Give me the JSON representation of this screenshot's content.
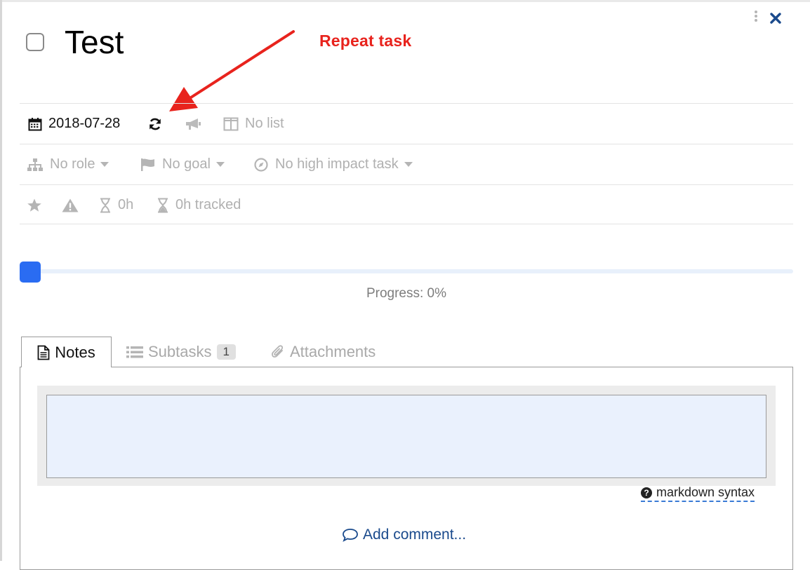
{
  "task": {
    "title": "Test",
    "completed": false
  },
  "annotation": {
    "text": "Repeat task"
  },
  "details": {
    "due_date": "2018-07-28",
    "list_label": "No list",
    "role_label": "No role",
    "goal_label": "No goal",
    "high_impact_label": "No high impact task",
    "estimate_label": "0h",
    "tracked_label": "0h tracked"
  },
  "progress": {
    "label": "Progress: 0%",
    "value": 0
  },
  "tabs": [
    {
      "label": "Notes",
      "icon": "document-icon",
      "active": true
    },
    {
      "label": "Subtasks",
      "icon": "list-icon",
      "badge": "1",
      "active": false
    },
    {
      "label": "Attachments",
      "icon": "paperclip-icon",
      "active": false
    }
  ],
  "notes": {
    "value": "",
    "markdown_link": "markdown syntax"
  },
  "comments": {
    "add_label": "Add comment..."
  },
  "colors": {
    "accent_blue": "#2a6cf2",
    "link_blue": "#1a4a8c",
    "annotation_red": "#e8231d",
    "muted_gray": "#b0b0b0"
  }
}
